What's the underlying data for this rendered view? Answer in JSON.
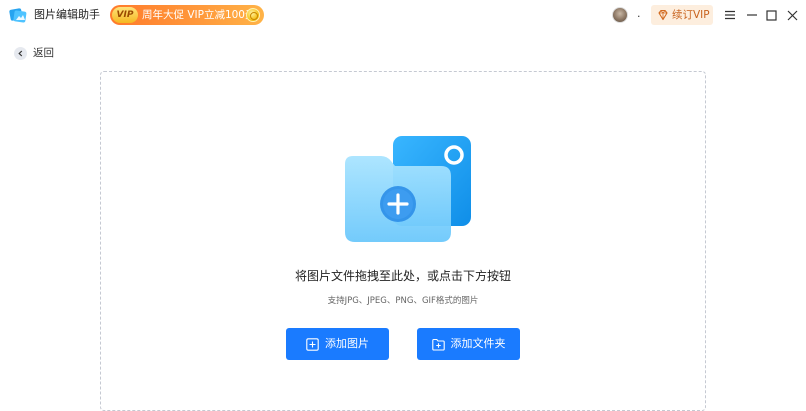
{
  "app": {
    "name": "图片编辑助手"
  },
  "promo": {
    "badge": "VIP",
    "text": "周年大促 VIP立减100元"
  },
  "user": {
    "name": "."
  },
  "vip": {
    "label": "续订VIP"
  },
  "back": {
    "label": "返回"
  },
  "dropzone": {
    "title": "将图片文件拖拽至此处，或点击下方按钮",
    "hint": "支持JPG、JPEG、PNG、GIF格式的图片",
    "add_image_label": "添加图片",
    "add_folder_label": "添加文件夹"
  },
  "colors": {
    "accent": "#1a7bff",
    "promo_orange": "#ff8a30",
    "vip_text": "#c8611c",
    "folder_front": "#7dd0fb",
    "folder_back": "#1fa1f2"
  },
  "icons": [
    "app-logo-icon",
    "coin-icon",
    "avatar",
    "diamond-icon",
    "menu-icon",
    "minimize-icon",
    "maximize-icon",
    "close-icon",
    "back-chevron-icon",
    "folder-image-icon",
    "add-image-icon",
    "add-folder-icon"
  ]
}
